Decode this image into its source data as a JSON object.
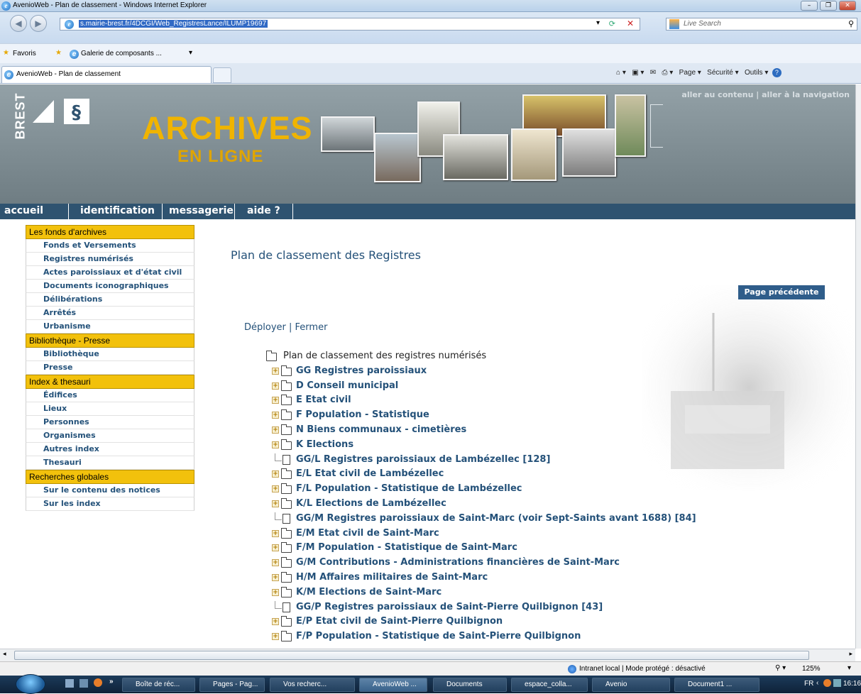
{
  "window": {
    "title": "AvenioWeb - Plan de classement - Windows Internet Explorer"
  },
  "address": {
    "url": "s.mairie-brest.fr/4DCGI/Web_RegistresLance/ILUMP19697",
    "search_placeholder": "Live Search"
  },
  "favorites": {
    "label": "Favoris",
    "gallery": "Galerie de composants ..."
  },
  "tab": {
    "title": "AvenioWeb - Plan de classement"
  },
  "commandbar": {
    "page": "Page ▾",
    "security": "Sécurité ▾",
    "tools": "Outils ▾"
  },
  "site": {
    "brand": "BREST",
    "title": "ARCHIVES",
    "subtitle": "EN LIGNE",
    "skiplinks": "aller au contenu | aller à la navigation",
    "nav": [
      "accueil",
      "identification",
      "messagerie",
      "aide ?"
    ]
  },
  "sidebar": {
    "sections": [
      {
        "title": "Les fonds d'archives",
        "items": [
          "Fonds et Versements",
          "Registres numérisés",
          "Actes paroissiaux et d'état civil",
          "Documents iconographiques",
          "Délibérations",
          "Arrêtés",
          "Urbanisme"
        ]
      },
      {
        "title": "Bibliothèque - Presse",
        "items": [
          "Bibliothèque",
          "Presse"
        ]
      },
      {
        "title": "Index & thesauri",
        "items": [
          "Édifices",
          "Lieux",
          "Personnes",
          "Organismes",
          "Autres index",
          "Thesauri"
        ]
      },
      {
        "title": "Recherches globales",
        "items": [
          "Sur le contenu des notices",
          "Sur les index"
        ]
      }
    ]
  },
  "main": {
    "title": "Plan de classement des Registres",
    "back_button": "Page précédente",
    "deploy": "Déployer",
    "close": "Fermer",
    "tree_root": "Plan de classement des registres numérisés",
    "tree": [
      {
        "type": "folder",
        "label": "GG Registres paroissiaux"
      },
      {
        "type": "folder",
        "label": "D Conseil municipal"
      },
      {
        "type": "folder",
        "label": "E Etat civil"
      },
      {
        "type": "folder",
        "label": "F Population - Statistique"
      },
      {
        "type": "folder",
        "label": "N Biens communaux - cimetières"
      },
      {
        "type": "folder",
        "label": "K Elections"
      },
      {
        "type": "doc",
        "label": "GG/L Registres paroissiaux de Lambézellec [128]"
      },
      {
        "type": "folder",
        "label": "E/L Etat civil de Lambézellec"
      },
      {
        "type": "folder",
        "label": "F/L Population - Statistique de Lambézellec"
      },
      {
        "type": "folder",
        "label": "K/L Elections de Lambézellec"
      },
      {
        "type": "doc",
        "label": "GG/M Registres paroissiaux de Saint-Marc (voir Sept-Saints avant 1688) [84]"
      },
      {
        "type": "folder",
        "label": "E/M Etat civil de Saint-Marc"
      },
      {
        "type": "folder",
        "label": "F/M Population - Statistique de Saint-Marc"
      },
      {
        "type": "folder",
        "label": "G/M Contributions - Administrations financières de Saint-Marc"
      },
      {
        "type": "folder",
        "label": "H/M Affaires militaires de Saint-Marc"
      },
      {
        "type": "folder",
        "label": "K/M Elections de Saint-Marc"
      },
      {
        "type": "doc",
        "label": "GG/P Registres paroissiaux de Saint-Pierre Quilbignon [43]"
      },
      {
        "type": "folder",
        "label": "E/P Etat civil de Saint-Pierre Quilbignon"
      },
      {
        "type": "folder",
        "label": "F/P Population - Statistique de Saint-Pierre Quilbignon"
      }
    ]
  },
  "statusbar": {
    "zone": "Intranet local | Mode protégé : désactivé",
    "zoom": "125%"
  },
  "taskbar": {
    "items": [
      "Boîte de réc...",
      "Pages - Pag...",
      "Vos recherc...",
      "AvenioWeb ...",
      "Documents",
      "espace_colla...",
      "Avenio",
      "Document1 ..."
    ],
    "lang": "FR",
    "clock": "16:16"
  },
  "colors": {
    "accent_yellow": "#f2c10c",
    "nav_blue": "#2f5370",
    "link_blue": "#245179"
  }
}
